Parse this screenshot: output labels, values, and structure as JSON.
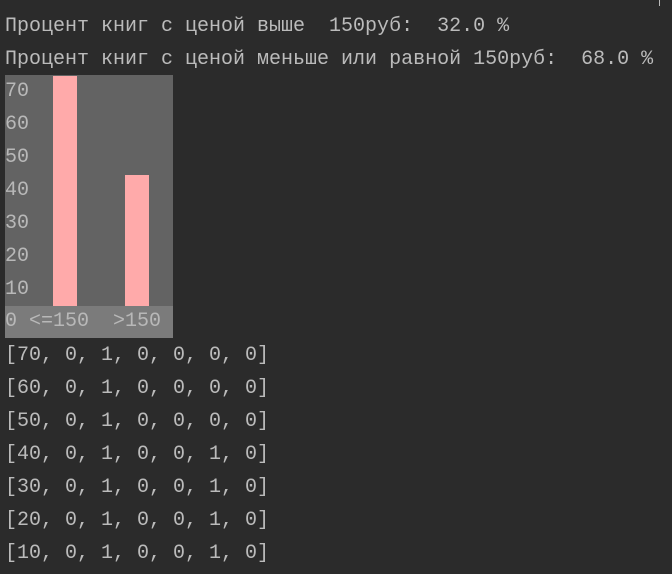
{
  "console": {
    "lines_top": [
      "Процент книг с ценой выше  150руб:  32.0 %",
      "Процент книг с ценой меньше или равной 150руб:  68.0 %"
    ],
    "matrix_rows": [
      "[70, 0, 1, 0, 0, 0, 0]",
      "[60, 0, 1, 0, 0, 0, 0]",
      "[50, 0, 1, 0, 0, 0, 0]",
      "[40, 0, 1, 0, 0, 1, 0]",
      "[30, 0, 1, 0, 0, 1, 0]",
      "[20, 0, 1, 0, 0, 1, 0]",
      "[10, 0, 1, 0, 0, 1, 0]"
    ]
  },
  "chart_data": {
    "type": "bar",
    "categories": [
      "<=150",
      ">150"
    ],
    "values": [
      75,
      45
    ],
    "y_ticks": [
      "70",
      "60",
      "50",
      "40",
      "30",
      "20",
      "10"
    ],
    "origin_label": "0",
    "ylim": [
      0,
      77
    ],
    "bar_color": "#ffaaaa",
    "title": "",
    "xlabel": "",
    "ylabel": ""
  }
}
